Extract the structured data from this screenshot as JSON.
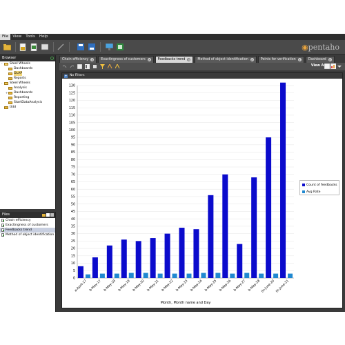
{
  "menu": [
    "File",
    "View",
    "Tools",
    "Help"
  ],
  "logo": {
    "text": "pentaho"
  },
  "browser": {
    "title": "Browser",
    "tree": [
      {
        "label": "Steel Wheels",
        "level": 0,
        "expander": "-",
        "open": true
      },
      {
        "label": "Dashboards",
        "level": 1
      },
      {
        "label": "OLAP",
        "level": 1,
        "selected": true
      },
      {
        "label": "Reports",
        "level": 1
      },
      {
        "label": "Steel Wheels",
        "level": 0,
        "expander": "-",
        "open": true
      },
      {
        "label": "Analysis",
        "level": 1
      },
      {
        "label": "Dashboards",
        "level": 1,
        "expander": "+"
      },
      {
        "label": "Reporting",
        "level": 1
      },
      {
        "label": "StartDataAnalysis",
        "level": 1
      },
      {
        "label": "tldd",
        "level": 0
      }
    ]
  },
  "files": {
    "title": "Files",
    "items": [
      "Chain efficiency",
      "Exactingness of customers",
      "Feedbacks trend",
      "Method of object identification"
    ],
    "selected_index": 2
  },
  "tabs": [
    {
      "label": "Chain efficiency",
      "active": false
    },
    {
      "label": "Exactingness of customers",
      "active": false
    },
    {
      "label": "Feedbacks trend",
      "active": true
    },
    {
      "label": "Method of object identification",
      "active": false
    },
    {
      "label": "Points for verification",
      "active": false
    },
    {
      "label": "Dashboard",
      "active": false
    }
  ],
  "report_toolbar": {
    "view_as_label": "View As:"
  },
  "filter_label": "No Filters",
  "colors": {
    "count_series": "#0b0bcc",
    "avg_series": "#1f88d0",
    "accent": "#e8a33d"
  },
  "chart_data": {
    "type": "bar",
    "xlabel": "Month, Month name and Day",
    "ylabel": "",
    "ylim": [
      0,
      130
    ],
    "ytick_step": 5,
    "grid": true,
    "legend_position": "right",
    "categories": [
      "a-April-17",
      "b-May-17",
      "b-May-18",
      "b-May-19",
      "b-May-20",
      "b-May-21",
      "b-May-22",
      "b-May-23",
      "b-May-24",
      "b-May-25",
      "b-May-26",
      "b-May-27",
      "b-May-28",
      "th-June-20",
      "th-June-21"
    ],
    "series": [
      {
        "name": "Count of feedbacks",
        "values": [
          8,
          14,
          22,
          26,
          25,
          27,
          30,
          34,
          33,
          56,
          70,
          23,
          68,
          95,
          132
        ]
      },
      {
        "name": "Avg Rate",
        "values": [
          2.5,
          3,
          3,
          3.5,
          3.5,
          3,
          3,
          3,
          3.5,
          3.5,
          3,
          3.5,
          3,
          3,
          3
        ]
      }
    ]
  }
}
